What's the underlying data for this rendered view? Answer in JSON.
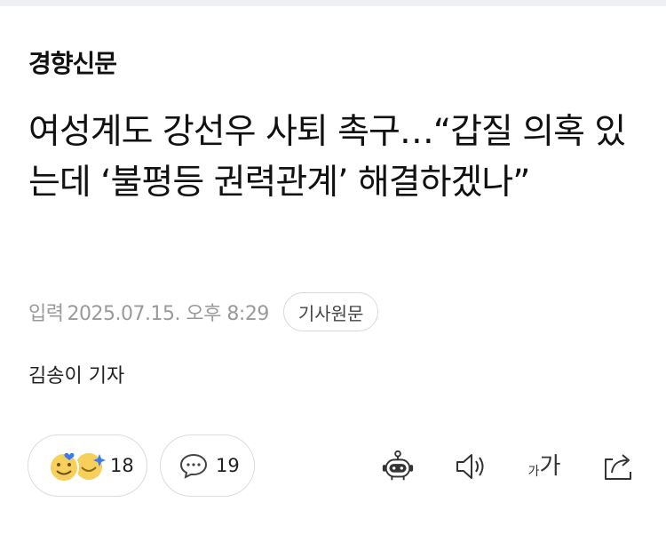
{
  "press": {
    "name": "경향신문"
  },
  "article": {
    "headline": "여성계도 강선우 사퇴 촉구…“갑질 의혹 있는데 ‘불평등 권력관계’ 해결하겠나”",
    "input_label": "입력",
    "date": "2025.07.15. 오후 8:29",
    "original_button": "기사원문",
    "reporter": "김송이 기자"
  },
  "actions": {
    "reaction_count": "18",
    "comment_count": "19",
    "font_small": "가",
    "font_large": "가",
    "icons": [
      "smile-emoji-icon",
      "sparkle-emoji-icon",
      "comment-icon",
      "robot-summary-icon",
      "speaker-icon",
      "font-size-icon",
      "share-icon"
    ]
  },
  "colors": {
    "emoji_yellow": "#f6cf5c",
    "heart_blue": "#3a7bf0",
    "border": "#dcdcdc",
    "meta_gray": "#9a9a9a"
  }
}
